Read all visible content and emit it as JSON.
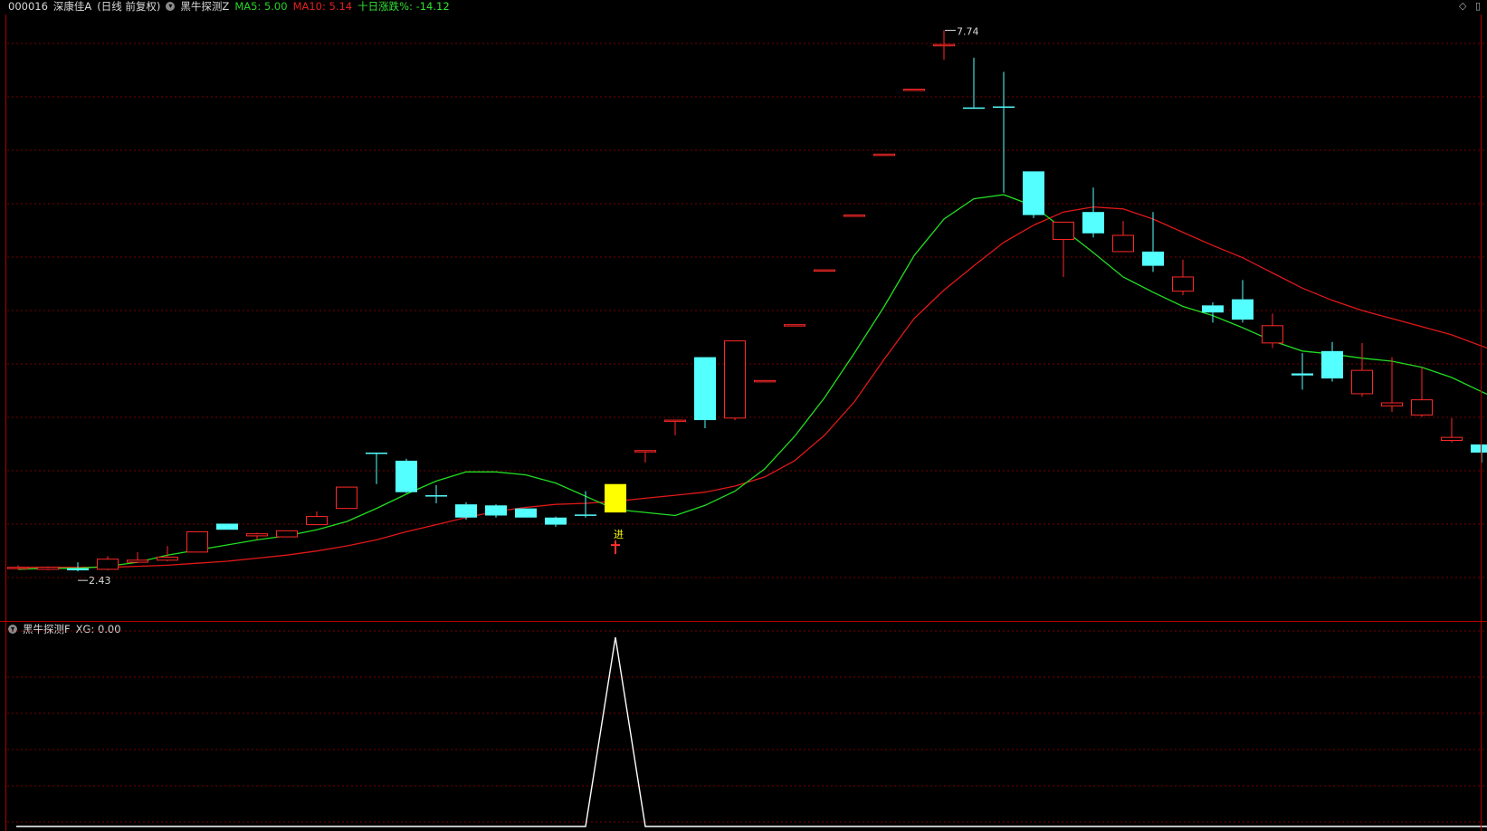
{
  "header": {
    "code": "000016",
    "name": "深康佳A",
    "period": "(日线 前复权)",
    "indicator": "黑牛探测Z",
    "ma5_label": "MA5: 5.00",
    "ma10_label": "MA10: 5.14",
    "ten_day_label": "十日涨跌%: -14.12"
  },
  "sub_header": {
    "indicator": "黑牛探测F",
    "xg_label": "XG: 0.00"
  },
  "annotations": {
    "high_label": "7.74",
    "low_label": "2.43",
    "signal_label": "进"
  },
  "colors": {
    "up": "#ff2828",
    "down": "#54ffff",
    "signal": "#ffff00",
    "ma5": "#22dd22",
    "ma10": "#e01818",
    "grid": "#7a0000",
    "xg_line": "#ffffff"
  },
  "chart_data": {
    "type": "candlestick",
    "title": "000016 深康佳A (日线 前复权)",
    "ylim": [
      1.93,
      7.86
    ],
    "candles": [
      [
        2.44,
        2.45,
        2.43,
        2.47
      ],
      [
        2.43,
        2.45,
        2.42,
        2.46
      ],
      [
        2.44,
        2.42,
        2.41,
        2.5
      ],
      [
        2.43,
        2.53,
        2.42,
        2.56
      ],
      [
        2.5,
        2.52,
        2.49,
        2.6
      ],
      [
        2.52,
        2.55,
        2.51,
        2.66
      ],
      [
        2.6,
        2.8,
        2.6,
        2.8
      ],
      [
        2.88,
        2.82,
        2.82,
        2.88
      ],
      [
        2.76,
        2.78,
        2.72,
        2.79
      ],
      [
        2.75,
        2.81,
        2.75,
        2.81
      ],
      [
        2.87,
        2.95,
        2.87,
        3.0
      ],
      [
        3.03,
        3.24,
        3.03,
        3.24
      ],
      [
        3.58,
        3.57,
        3.27,
        3.58
      ],
      [
        3.5,
        3.19,
        3.18,
        3.52
      ],
      [
        3.16,
        3.15,
        3.08,
        3.26
      ],
      [
        3.07,
        2.94,
        2.92,
        3.09
      ],
      [
        3.06,
        2.96,
        2.94,
        3.07
      ],
      [
        3.03,
        2.94,
        2.94,
        3.03
      ],
      [
        2.94,
        2.87,
        2.85,
        2.95
      ],
      [
        2.97,
        2.96,
        2.94,
        3.2
      ],
      [
        2.99,
        3.27,
        2.99,
        3.27
      ],
      [
        3.6,
        3.6,
        3.48,
        3.6
      ],
      [
        3.9,
        3.9,
        3.75,
        3.9
      ],
      [
        4.52,
        3.9,
        3.82,
        4.52
      ],
      [
        3.92,
        4.68,
        3.9,
        4.68
      ],
      [
        4.29,
        4.29,
        4.29,
        4.29
      ],
      [
        4.84,
        4.84,
        4.84,
        4.84
      ],
      [
        5.38,
        5.38,
        5.38,
        5.38
      ],
      [
        5.92,
        5.92,
        5.92,
        5.92
      ],
      [
        6.52,
        6.52,
        6.52,
        6.52
      ],
      [
        7.16,
        7.16,
        7.16,
        7.16
      ],
      [
        7.6,
        7.6,
        7.45,
        7.74
      ],
      [
        6.98,
        6.97,
        6.97,
        7.47
      ],
      [
        6.99,
        6.98,
        6.14,
        7.33
      ],
      [
        6.35,
        5.92,
        5.89,
        6.35
      ],
      [
        5.68,
        5.85,
        5.31,
        5.85
      ],
      [
        5.95,
        5.74,
        5.7,
        6.19
      ],
      [
        5.56,
        5.72,
        5.68,
        5.86
      ],
      [
        5.56,
        5.42,
        5.36,
        5.95
      ],
      [
        5.17,
        5.31,
        5.13,
        5.48
      ],
      [
        5.03,
        4.96,
        4.86,
        5.06
      ],
      [
        5.09,
        4.89,
        4.86,
        5.28
      ],
      [
        4.66,
        4.83,
        4.61,
        4.95
      ],
      [
        4.36,
        4.34,
        4.2,
        4.56
      ],
      [
        4.58,
        4.31,
        4.28,
        4.67
      ],
      [
        4.16,
        4.39,
        4.13,
        4.66
      ],
      [
        4.04,
        4.07,
        3.98,
        4.52
      ],
      [
        3.95,
        4.1,
        3.93,
        4.42
      ],
      [
        3.7,
        3.73,
        3.68,
        3.92
      ],
      [
        3.66,
        3.58,
        3.48,
        3.66
      ],
      [
        3.46,
        3.55,
        3.38,
        3.55
      ],
      [
        3.55,
        3.51,
        3.42,
        3.7
      ]
    ],
    "ma5": [
      2.43,
      2.44,
      2.44,
      2.46,
      2.5,
      2.57,
      2.62,
      2.67,
      2.72,
      2.76,
      2.82,
      2.9,
      3.03,
      3.17,
      3.3,
      3.39,
      3.39,
      3.36,
      3.28,
      3.15,
      3.02,
      2.99,
      2.96,
      3.06,
      3.2,
      3.42,
      3.74,
      4.12,
      4.56,
      5.02,
      5.52,
      5.88,
      6.08,
      6.12,
      6.01,
      5.78,
      5.55,
      5.31,
      5.16,
      5.02,
      4.93,
      4.81,
      4.68,
      4.58,
      4.55,
      4.51,
      4.48,
      4.42,
      4.32,
      4.18,
      4.05,
      3.95
    ],
    "ma10": [
      2.45,
      2.45,
      2.45,
      2.45,
      2.46,
      2.47,
      2.49,
      2.51,
      2.54,
      2.57,
      2.61,
      2.66,
      2.72,
      2.8,
      2.87,
      2.94,
      3.0,
      3.04,
      3.07,
      3.08,
      3.1,
      3.13,
      3.16,
      3.19,
      3.25,
      3.34,
      3.5,
      3.75,
      4.08,
      4.5,
      4.9,
      5.18,
      5.42,
      5.65,
      5.82,
      5.95,
      6.0,
      5.98,
      5.88,
      5.75,
      5.62,
      5.5,
      5.35,
      5.2,
      5.08,
      4.98,
      4.9,
      4.82,
      4.74,
      4.63,
      4.52,
      4.4
    ],
    "signal_index": 20,
    "xg": [
      0,
      0,
      0,
      0,
      0,
      0,
      0,
      0,
      0,
      0,
      0,
      0,
      0,
      0,
      0,
      0,
      0,
      0,
      0,
      0,
      1,
      0,
      0,
      0,
      0,
      0,
      0,
      0,
      0,
      0,
      0,
      0,
      0,
      0,
      0,
      0,
      0,
      0,
      0,
      0,
      0,
      0,
      0,
      0,
      0,
      0,
      0,
      0,
      0,
      0,
      0,
      0
    ],
    "series": [
      {
        "name": "MA5",
        "color": "#22dd22"
      },
      {
        "name": "MA10",
        "color": "#e01818"
      },
      {
        "name": "XG",
        "color": "#ffffff"
      }
    ]
  }
}
